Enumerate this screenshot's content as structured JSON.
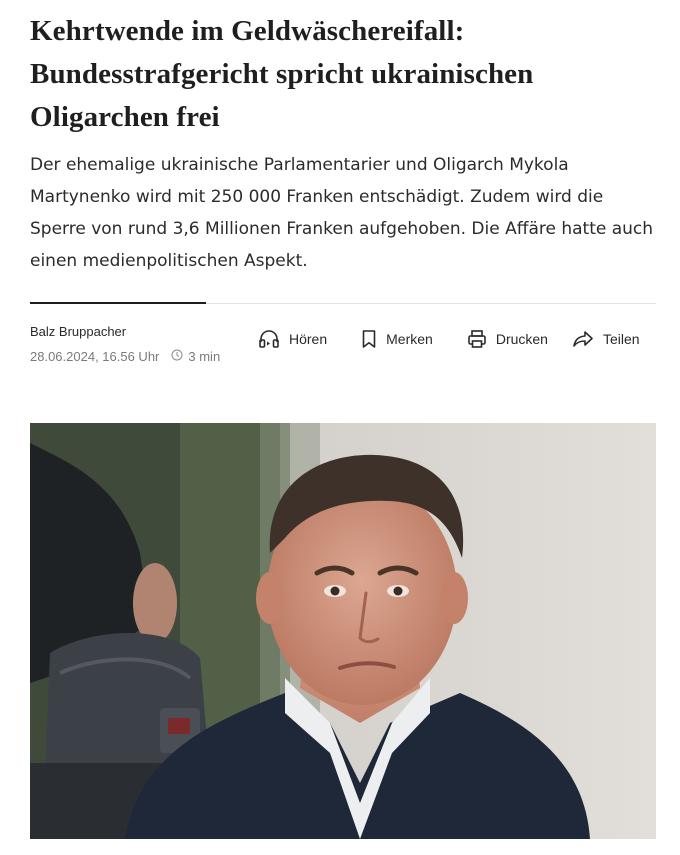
{
  "article": {
    "headline": "Kehrtwende im Geldwäschereifall: Bundesstrafgericht spricht ukrainischen Oligarchen frei",
    "lead": "Der ehemalige ukrainische Parlamentarier und Oligarch Mykola Martynenko wird mit 250 000 Franken entschädigt. Zudem wird die Sperre von rund 3,6 Millionen Franken aufgehoben. Die Affäre hatte auch einen medienpolitischen Aspekt.",
    "author": "Balz Bruppacher",
    "date": "28.06.2024, 16.56 Uhr",
    "read_time": "3 min"
  },
  "actions": {
    "listen": "Hören",
    "bookmark": "Merken",
    "print": "Drucken",
    "share": "Teilen"
  },
  "icons": [
    "headphones-icon",
    "bookmark-icon",
    "printer-icon",
    "share-icon",
    "clock-icon"
  ],
  "colors": {
    "text": "#1f1f1f",
    "muted": "#7a7a7a",
    "rule": "#e3e3e3"
  }
}
